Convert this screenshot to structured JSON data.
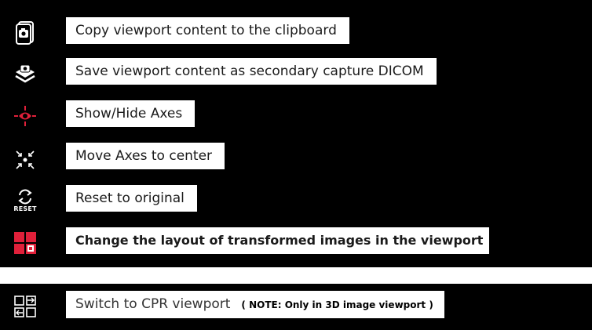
{
  "items": [
    {
      "label": "Copy viewport content to the clipboard",
      "icon": "camera-clipboard-icon"
    },
    {
      "label": "Save viewport content as secondary capture DICOM",
      "icon": "save-capture-icon"
    },
    {
      "label": "Show/Hide Axes",
      "icon": "eye-axes-icon"
    },
    {
      "label": "Move Axes to center",
      "icon": "move-axes-center-icon"
    },
    {
      "label": "Reset to original",
      "icon": "reset-icon",
      "icon_text": "RESET"
    },
    {
      "label": "Change the layout of transformed images in the viewport",
      "icon": "layout-grid-icon"
    }
  ],
  "cpr": {
    "label": "Switch to CPR viewport",
    "note": "( NOTE: Only in 3D image viewport )",
    "icon": "switch-cpr-icon"
  },
  "colors": {
    "background": "#000000",
    "accent_red": "#e0203a",
    "icon_white": "#ffffff"
  }
}
